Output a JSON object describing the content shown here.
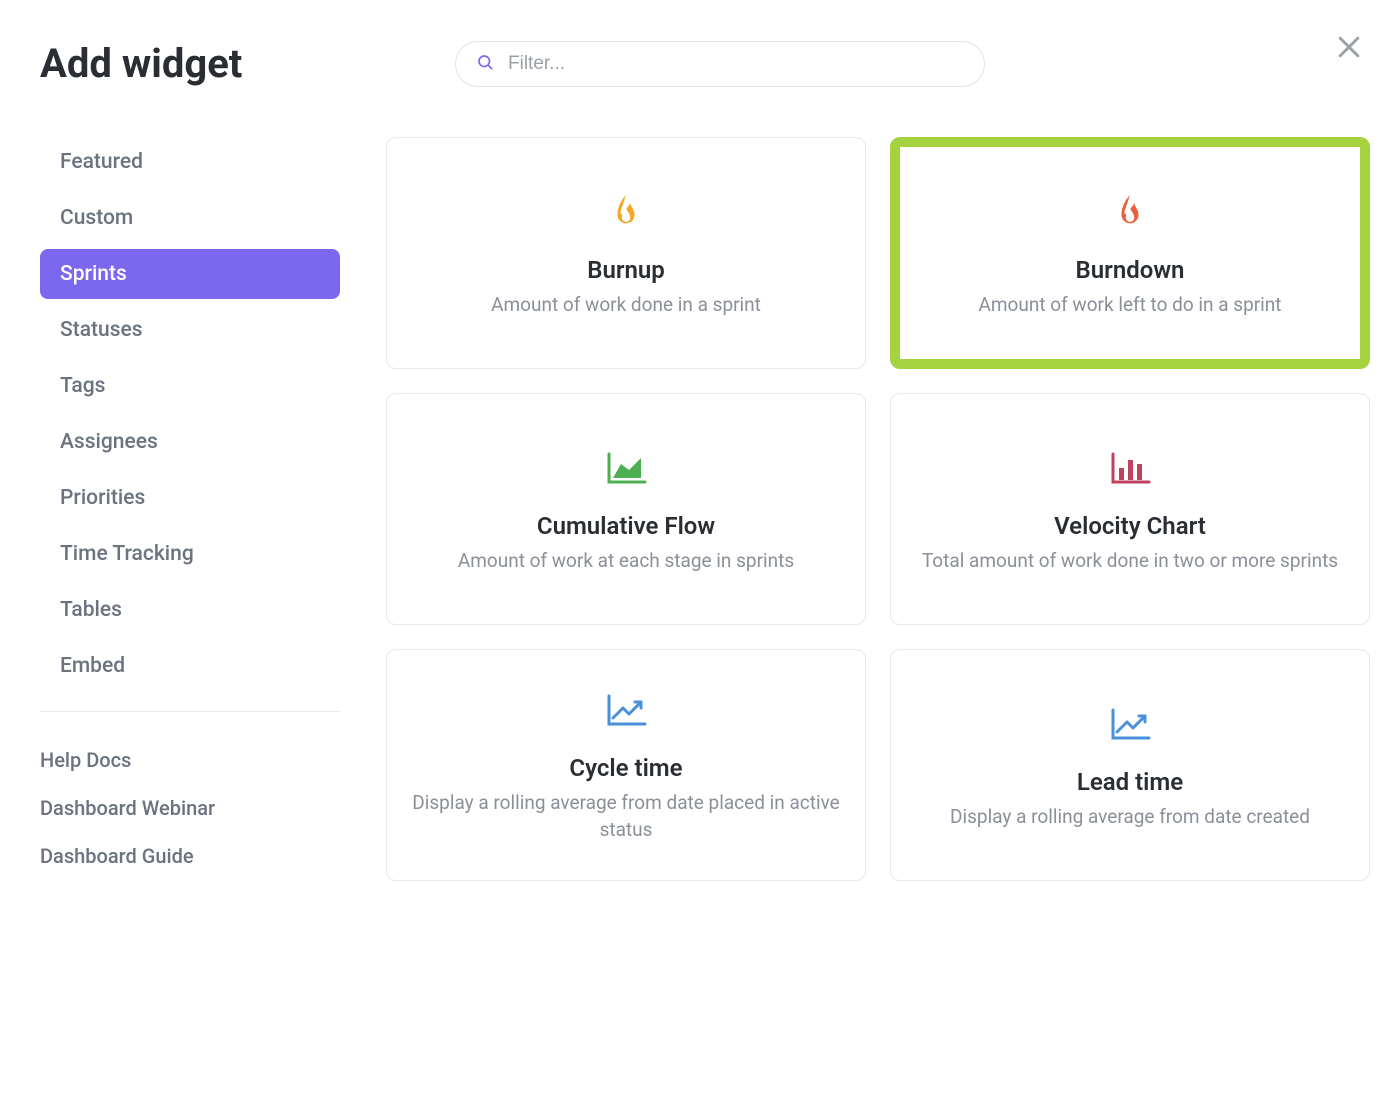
{
  "header": {
    "title": "Add widget",
    "search_placeholder": "Filter..."
  },
  "sidebar": {
    "categories": [
      {
        "label": "Featured",
        "active": false
      },
      {
        "label": "Custom",
        "active": false
      },
      {
        "label": "Sprints",
        "active": true
      },
      {
        "label": "Statuses",
        "active": false
      },
      {
        "label": "Tags",
        "active": false
      },
      {
        "label": "Assignees",
        "active": false
      },
      {
        "label": "Priorities",
        "active": false
      },
      {
        "label": "Time Tracking",
        "active": false
      },
      {
        "label": "Tables",
        "active": false
      },
      {
        "label": "Embed",
        "active": false
      }
    ],
    "help_links": [
      {
        "label": "Help Docs"
      },
      {
        "label": "Dashboard Webinar"
      },
      {
        "label": "Dashboard Guide"
      }
    ]
  },
  "widgets": [
    {
      "title": "Burnup",
      "desc": "Amount of work done in a sprint",
      "icon": "flame-yellow",
      "selected": false
    },
    {
      "title": "Burndown",
      "desc": "Amount of work left to do in a sprint",
      "icon": "flame-orange",
      "selected": true
    },
    {
      "title": "Cumulative Flow",
      "desc": "Amount of work at each stage in sprints",
      "icon": "area-chart-icon",
      "selected": false
    },
    {
      "title": "Velocity Chart",
      "desc": "Total amount of work done in two or more sprints",
      "icon": "bar-chart-icon",
      "selected": false
    },
    {
      "title": "Cycle time",
      "desc": "Display a rolling average from date placed in active status",
      "icon": "trend-chart-icon",
      "selected": false
    },
    {
      "title": "Lead time",
      "desc": "Display a rolling average from date created",
      "icon": "trend-chart-icon",
      "selected": false
    }
  ]
}
